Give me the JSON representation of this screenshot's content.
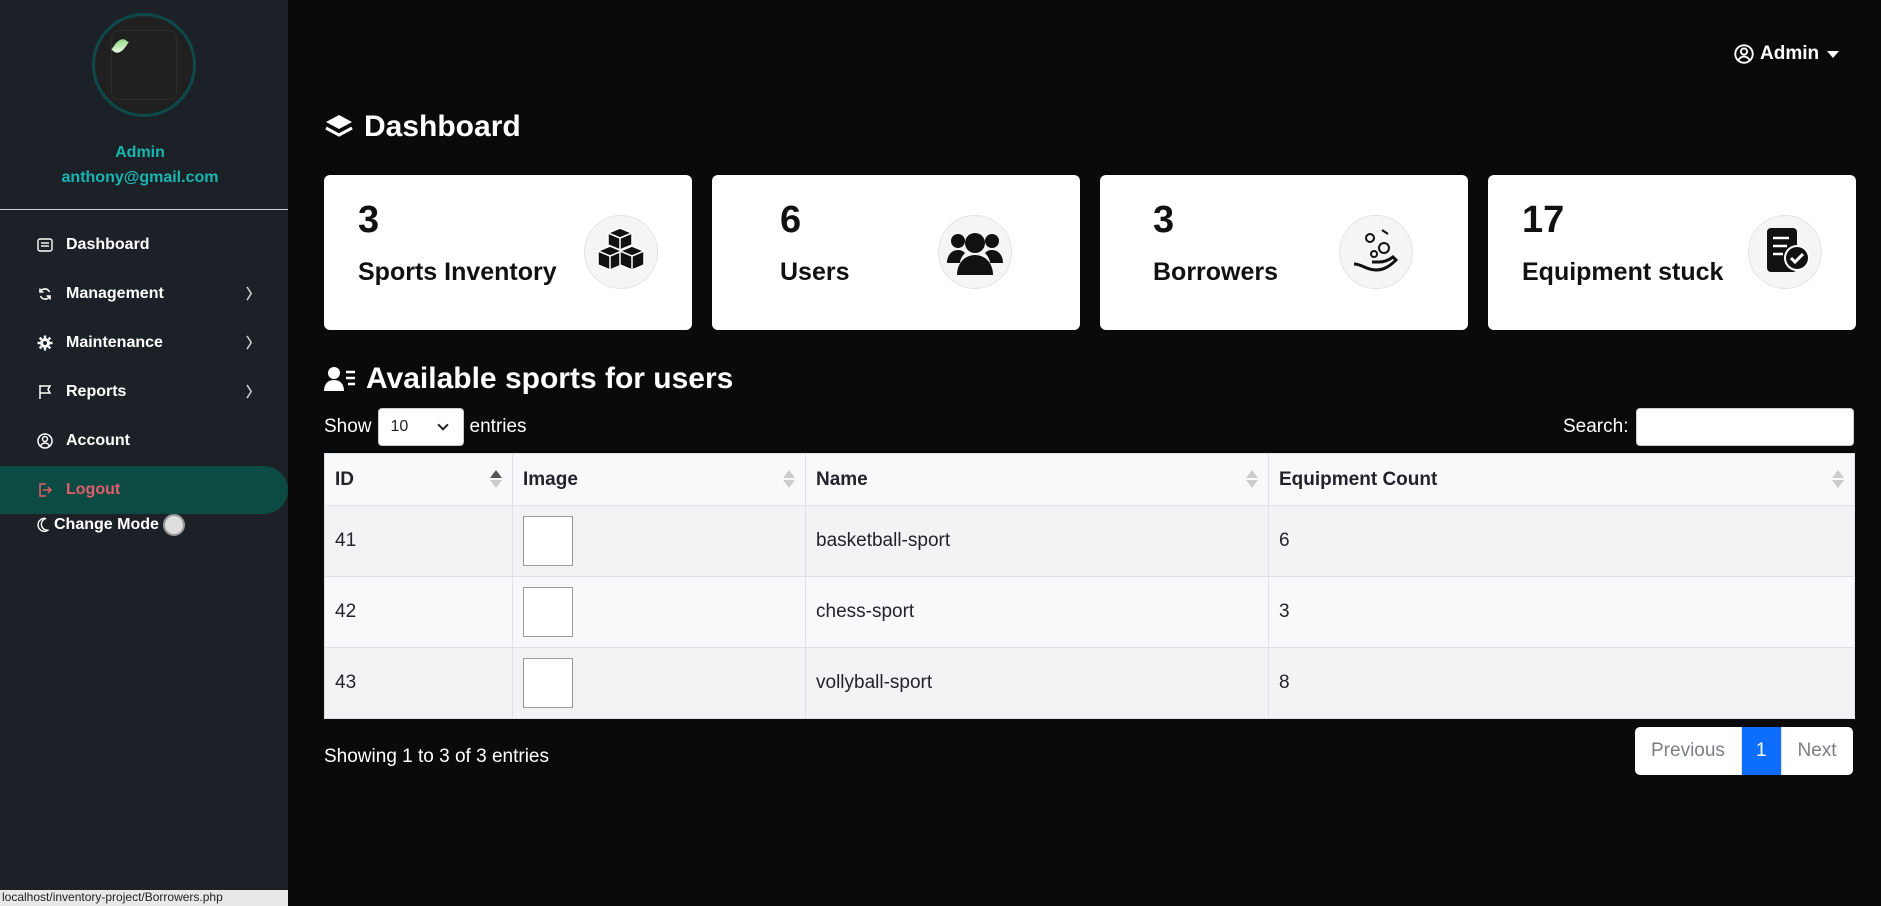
{
  "sidebar": {
    "user_name": "Admin",
    "user_email": "anthony@gmail.com",
    "items": [
      {
        "label": "Dashboard"
      },
      {
        "label": "Management"
      },
      {
        "label": "Maintenance"
      },
      {
        "label": "Reports"
      },
      {
        "label": "Account"
      },
      {
        "label": "Logout"
      }
    ],
    "change_mode_label": "Change Mode",
    "status_url": "localhost/inventory-project/Borrowers.php"
  },
  "header": {
    "admin_label": "Admin"
  },
  "page_title": "Dashboard",
  "cards": [
    {
      "value": "3",
      "label": "Sports Inventory",
      "icon": "boxes-icon"
    },
    {
      "value": "6",
      "label": "Users",
      "icon": "users-group-icon"
    },
    {
      "value": "3",
      "label": "Borrowers",
      "icon": "hand-coins-icon"
    },
    {
      "value": "17",
      "label": "Equipment stuck",
      "icon": "document-check-icon"
    }
  ],
  "section_title": "Available sports for users",
  "table_controls": {
    "show_label": "Show",
    "page_size": "10",
    "entries_label": "entries",
    "search_label": "Search:"
  },
  "table": {
    "columns": [
      "ID",
      "Image",
      "Name",
      "Equipment Count"
    ],
    "rows": [
      {
        "id": "41",
        "name": "basketball-sport",
        "count": "6"
      },
      {
        "id": "42",
        "name": "chess-sport",
        "count": "3"
      },
      {
        "id": "43",
        "name": "vollyball-sport",
        "count": "8"
      }
    ]
  },
  "footer": {
    "info": "Showing 1 to 3 of 3 entries",
    "previous": "Previous",
    "page": "1",
    "next": "Next"
  },
  "colors": {
    "accent_teal": "#17b6b0",
    "logout_red": "#e35d6a",
    "pager_active": "#0d6efd"
  }
}
